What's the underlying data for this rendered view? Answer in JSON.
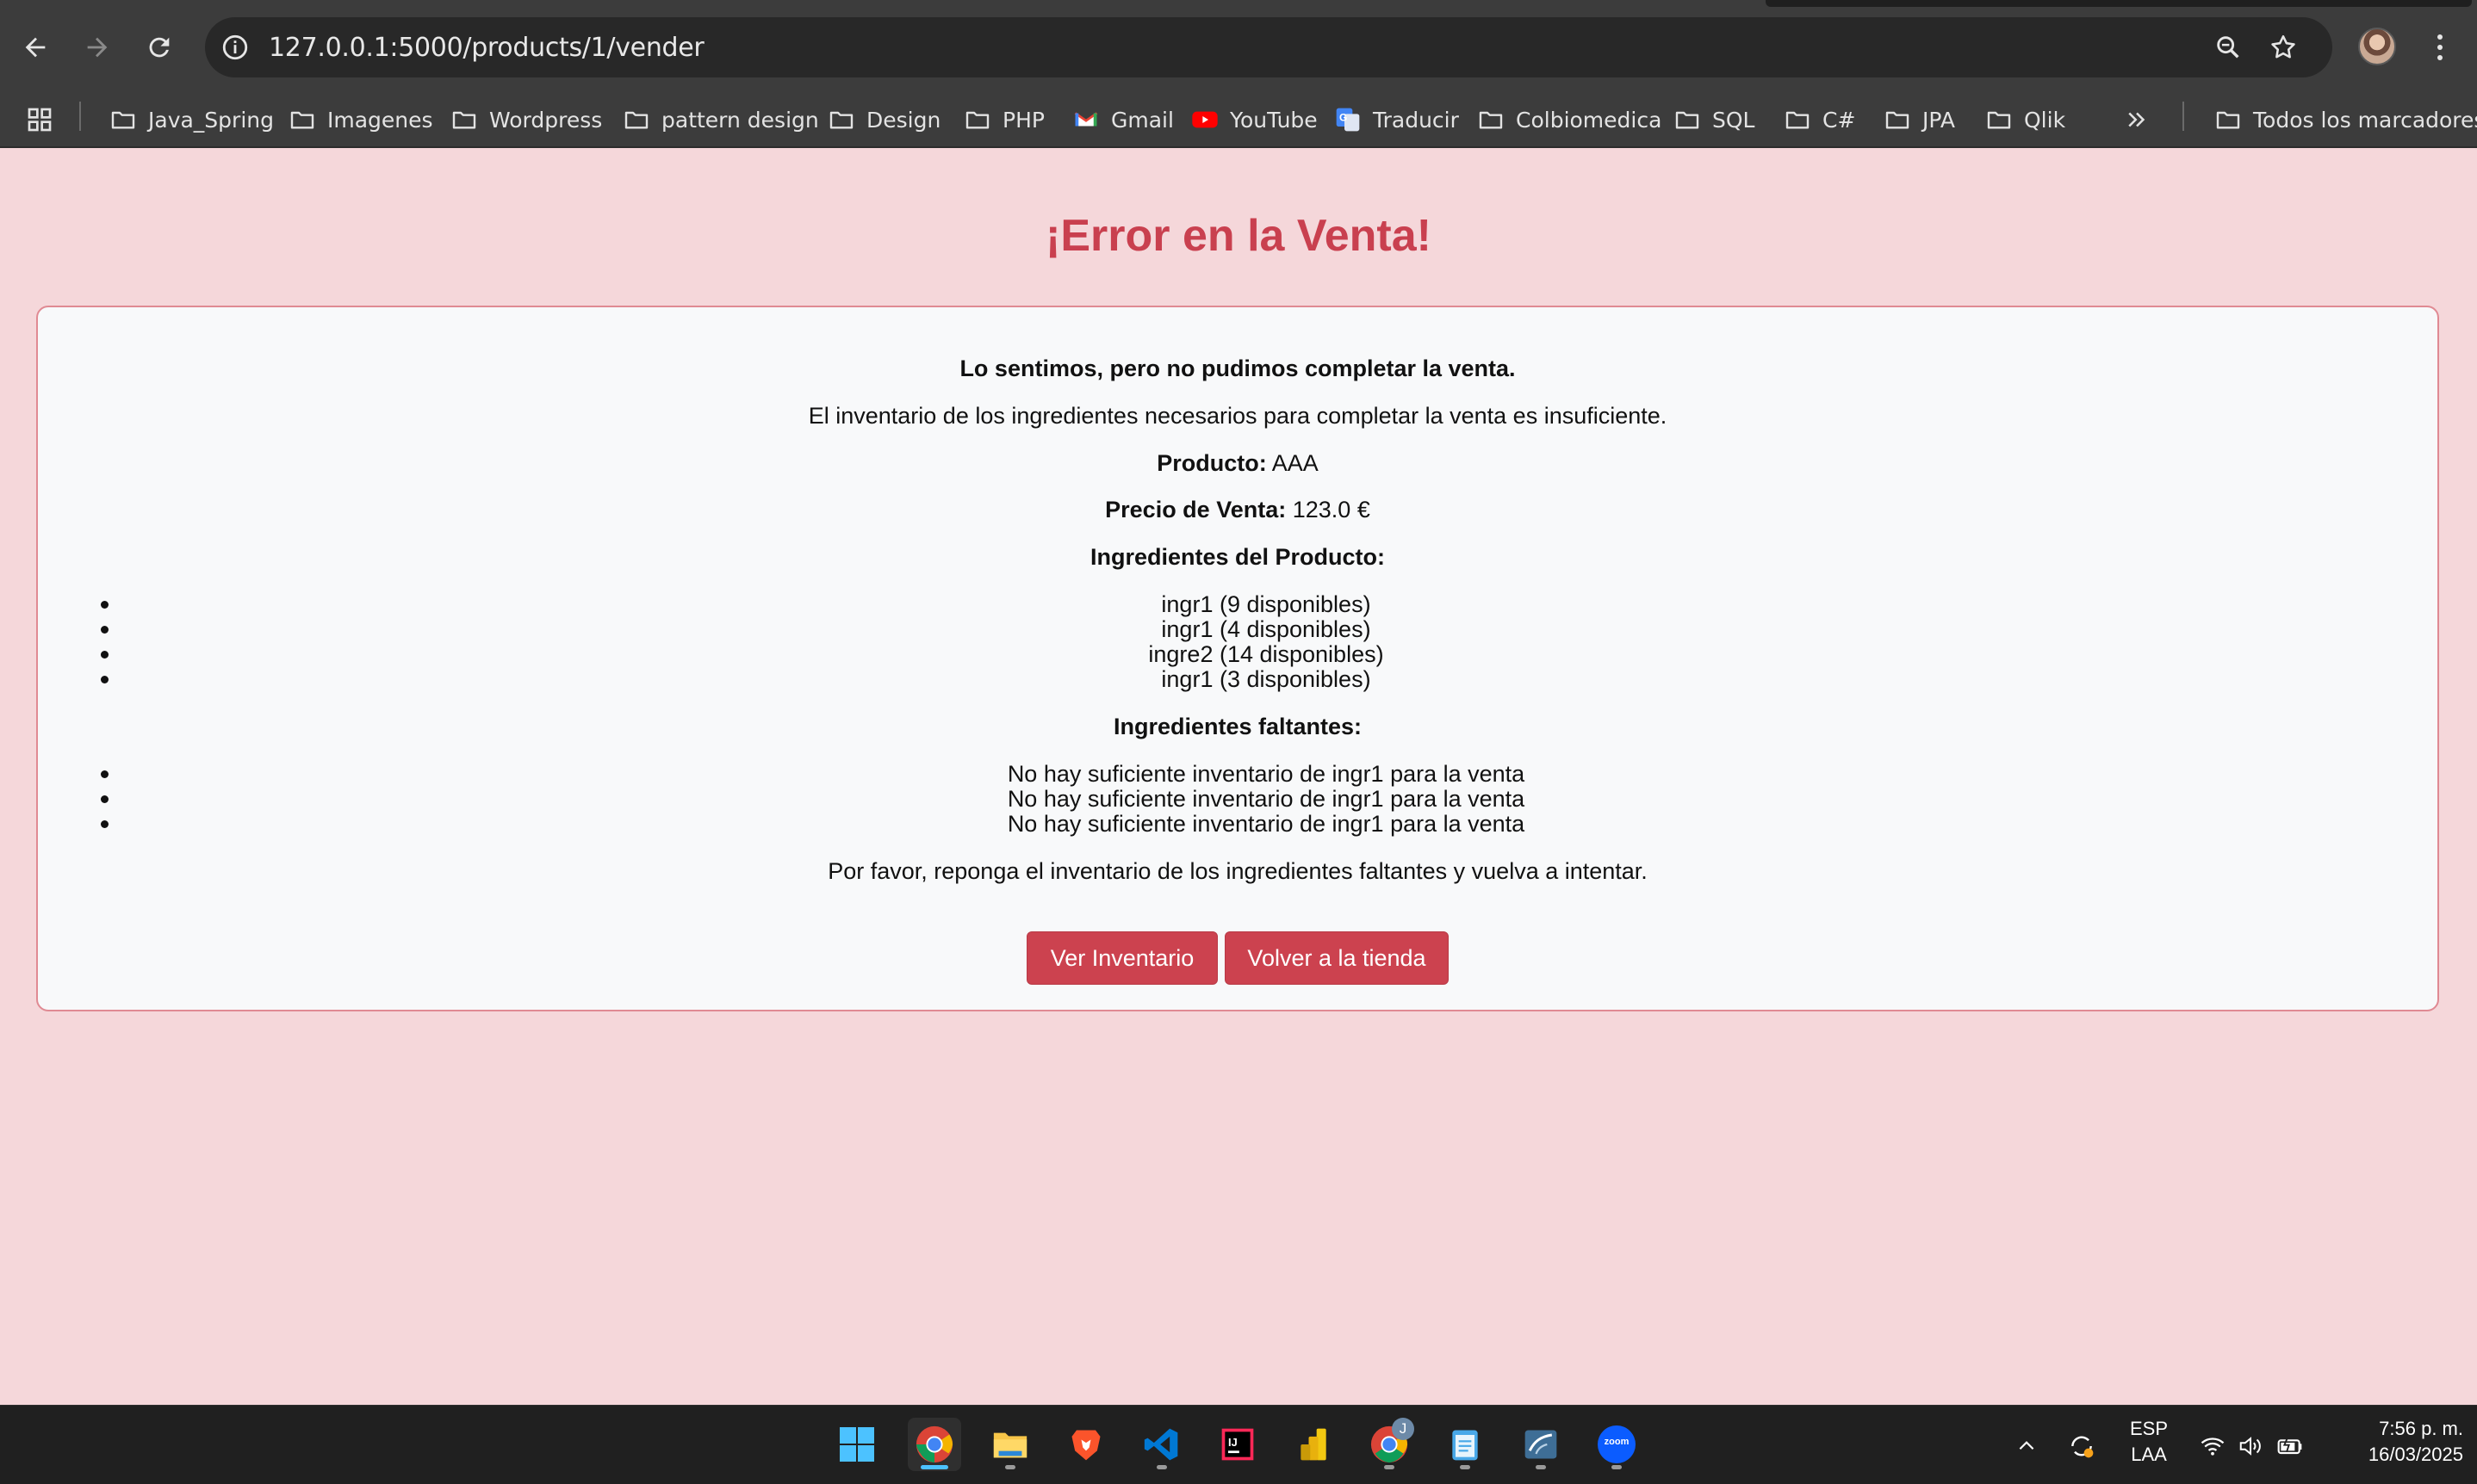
{
  "browser": {
    "url": "127.0.0.1:5000/products/1/vender"
  },
  "bookmarks": [
    {
      "label": "Java_Spring",
      "icon": "folder-icon"
    },
    {
      "label": "Imagenes",
      "icon": "folder-icon"
    },
    {
      "label": "Wordpress",
      "icon": "folder-icon"
    },
    {
      "label": "pattern design",
      "icon": "folder-icon"
    },
    {
      "label": "Design",
      "icon": "folder-icon"
    },
    {
      "label": "PHP",
      "icon": "folder-icon"
    },
    {
      "label": "Gmail",
      "icon": "gmail-icon"
    },
    {
      "label": "YouTube",
      "icon": "youtube-icon"
    },
    {
      "label": "Traducir",
      "icon": "translate-icon"
    },
    {
      "label": "Colbiomedica",
      "icon": "folder-icon"
    },
    {
      "label": "SQL",
      "icon": "folder-icon"
    },
    {
      "label": "C#",
      "icon": "folder-icon"
    },
    {
      "label": "JPA",
      "icon": "folder-icon"
    },
    {
      "label": "Qlik",
      "icon": "folder-icon"
    }
  ],
  "all_bookmarks_label": "Todos los marcadores",
  "page": {
    "title": "¡Error en la Venta!",
    "apology": "Lo sentimos, pero no pudimos completar la venta.",
    "message": "El inventario de los ingredientes necesarios para completar la venta es insuficiente.",
    "product_label": "Producto:",
    "product_value": "AAA",
    "price_label": "Precio de Venta:",
    "price_value": "123.0 €",
    "ingredients_heading": "Ingredientes del Producto:",
    "ingredients": [
      "ingr1 (9 disponibles)",
      "ingr1 (4 disponibles)",
      "ingre2 (14 disponibles)",
      "ingr1 (3 disponibles)"
    ],
    "missing_heading": "Ingredientes faltantes:",
    "missing": [
      "No hay suficiente inventario de ingr1 para la venta",
      "No hay suficiente inventario de ingr1 para la venta",
      "No hay suficiente inventario de ingr1 para la venta"
    ],
    "instructions": "Por favor, reponga el inventario de los ingredientes faltantes y vuelva a intentar.",
    "btn_inventory": "Ver Inventario",
    "btn_store": "Volver a la tienda"
  },
  "colors": {
    "accent": "#cc424f",
    "page_bg": "#f5d7da",
    "title": "#c9404f"
  },
  "taskbar": {
    "apps": [
      "windows-start-icon",
      "chrome-icon",
      "file-explorer-icon",
      "brave-icon",
      "vscode-icon",
      "intellij-icon",
      "power-bi-icon",
      "chrome-profile-icon",
      "notepad-icon",
      "mysql-workbench-icon",
      "zoom-icon"
    ],
    "chrome_profile_badge": "J",
    "zoom_label": "zoom",
    "lang_1": "ESP",
    "lang_2": "LAA",
    "time": "7:56 p. m.",
    "date": "16/03/2025"
  }
}
